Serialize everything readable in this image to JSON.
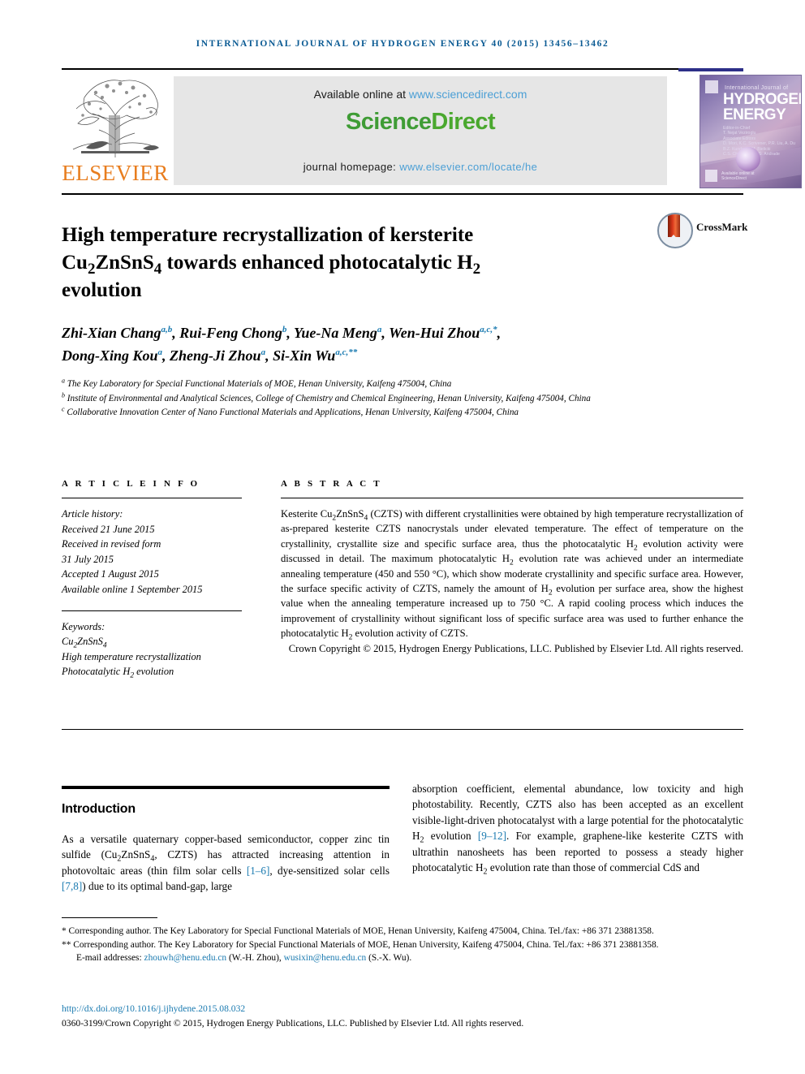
{
  "running_head": "INTERNATIONAL JOURNAL OF HYDROGEN ENERGY 40 (2015) 13456–13462",
  "masthead": {
    "publisher_name": "ELSEVIER",
    "available_prefix": "Available online at ",
    "available_url": "www.sciencedirect.com",
    "sciencedirect_part1": "Science",
    "sciencedirect_part2": "Direct",
    "homepage_prefix": "journal homepage: ",
    "homepage_url": "www.elsevier.com/locate/he",
    "cover": {
      "line_small": "International Journal of",
      "line_big_1": "HYDROGEN",
      "line_big_2": "ENERGY",
      "meta": "Editor-in-Chief\nT. Nejat Veziroglu\nAssociate Editors\nD. Mori, K.C. Scrivener, P.R. Liu, A. Du\nB.Z. Kundev, J.M. Bielicki\nC.S. Che, T. Graff, G. Andrade",
      "sciencedirect_mini": "Available online at\nScienceDirect"
    }
  },
  "article": {
    "title_line1": "High temperature recrystallization of kersterite",
    "title_line2_a": "Cu",
    "title_line2_sub1": "2",
    "title_line2_b": "ZnSnS",
    "title_line2_sub2": "4",
    "title_line2_c": " towards enhanced photocatalytic H",
    "title_line2_sub3": "2",
    "title_line3": "evolution",
    "crossmark_label": "CrossMark",
    "authors": [
      {
        "name": "Zhi-Xian Chang",
        "marks": "a,b",
        "sep": ", "
      },
      {
        "name": "Rui-Feng Chong",
        "marks": "b",
        "sep": ", "
      },
      {
        "name": "Yue-Na Meng",
        "marks": "a",
        "sep": ", "
      },
      {
        "name": "Wen-Hui Zhou",
        "marks": "a,c,*",
        "sep": ", "
      },
      {
        "name": "Dong-Xing Kou",
        "marks": "a",
        "sep": ", "
      },
      {
        "name": "Zheng-Ji Zhou",
        "marks": "a",
        "sep": ", "
      },
      {
        "name": "Si-Xin Wu",
        "marks": "a,c,**",
        "sep": ""
      }
    ],
    "affiliations": [
      {
        "mark": "a",
        "text": "The Key Laboratory for Special Functional Materials of MOE, Henan University, Kaifeng 475004, China"
      },
      {
        "mark": "b",
        "text": "Institute of Environmental and Analytical Sciences, College of Chemistry and Chemical Engineering, Henan University, Kaifeng 475004, China"
      },
      {
        "mark": "c",
        "text": "Collaborative Innovation Center of Nano Functional Materials and Applications, Henan University, Kaifeng 475004, China"
      }
    ]
  },
  "article_info": {
    "heading": "A R T I C L E   I N F O",
    "history_label": "Article history:",
    "history": [
      "Received 21 June 2015",
      "Received in revised form",
      "31 July 2015",
      "Accepted 1 August 2015",
      "Available online 1 September 2015"
    ],
    "keywords_label": "Keywords:",
    "keywords": [
      "Cu2ZnSnS4",
      "High temperature recrystallization",
      "Photocatalytic H2 evolution"
    ]
  },
  "abstract": {
    "heading": "A B S T R A C T",
    "text": "Kesterite Cu2ZnSnS4 (CZTS) with different crystallinities were obtained by high temperature recrystallization of as-prepared kesterite CZTS nanocrystals under elevated temperature. The effect of temperature on the crystallinity, crystallite size and specific surface area, thus the photocatalytic H2 evolution activity were discussed in detail. The maximum photocatalytic H2 evolution rate was achieved under an intermediate annealing temperature (450 and 550 °C), which show moderate crystallinity and specific surface area. However, the surface specific activity of CZTS, namely the amount of H2 evolution per surface area, show the highest value when the annealing temperature increased up to 750 °C. A rapid cooling process which induces the improvement of crystallinity without significant loss of specific surface area was used to further enhance the photocatalytic H2 evolution activity of CZTS.",
    "copyright": "Crown Copyright © 2015, Hydrogen Energy Publications, LLC. Published by Elsevier Ltd. All rights reserved."
  },
  "body": {
    "intro_heading": "Introduction",
    "left_paragraph": "As a versatile quaternary copper-based semiconductor, copper zinc tin sulfide (Cu2ZnSnS4, CZTS) has attracted increasing attention in photovoltaic areas (thin film solar cells [1–6], dye-sensitized solar cells [7,8]) due to its optimal band-gap, large",
    "right_paragraph": "absorption coefficient, elemental abundance, low toxicity and high photostability. Recently, CZTS also has been accepted as an excellent visible-light-driven photocatalyst with a large potential for the photocatalytic H2 evolution [9–12]. For example, graphene-like kesterite CZTS with ultrathin nanosheets has been reported to possess a steady higher photocatalytic H2 evolution rate than those of commercial CdS and",
    "ref_1_6": "[1–6]",
    "ref_7_8": "[7,8]",
    "ref_9_12": "[9–12]"
  },
  "footnotes": {
    "note1": "* Corresponding author. The Key Laboratory for Special Functional Materials of MOE, Henan University, Kaifeng 475004, China. Tel./fax: +86 371 23881358.",
    "note2": "** Corresponding author. The Key Laboratory for Special Functional Materials of MOE, Henan University, Kaifeng 475004, China. Tel./fax: +86 371 23881358.",
    "email_label": "E-mail addresses:",
    "email1": "zhouwh@henu.edu.cn",
    "email1_who": "(W.-H. Zhou),",
    "email2": "wusixin@henu.edu.cn",
    "email2_who": "(S.-X. Wu).",
    "doi": "http://dx.doi.org/10.1016/j.ijhydene.2015.08.032",
    "issn_copyright": "0360-3199/Crown Copyright © 2015, Hydrogen Energy Publications, LLC. Published by Elsevier Ltd. All rights reserved."
  },
  "colors": {
    "running_head": "#0a5a93",
    "link": "#1a7ab0",
    "elsevier_orange": "#E87D1E",
    "sciencedirect_green": "#3f9c35",
    "sd_link_blue": "#4b9fd5"
  }
}
